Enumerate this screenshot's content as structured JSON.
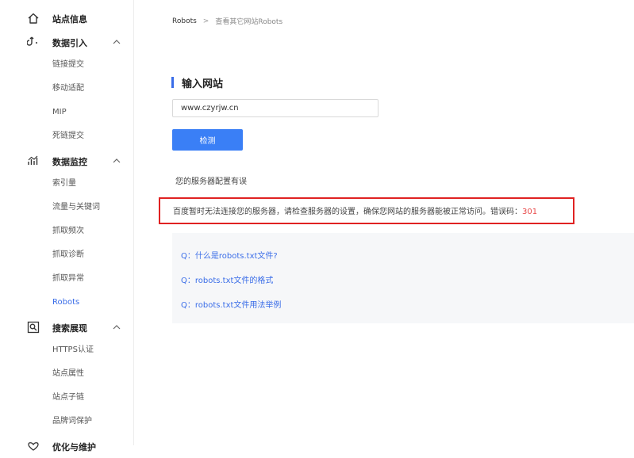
{
  "sidebar": {
    "groups": [
      {
        "label": "站点信息",
        "icon": "home-icon"
      },
      {
        "label": "数据引入",
        "icon": "data-import-icon",
        "items": [
          "链接提交",
          "移动适配",
          "MIP",
          "死链提交"
        ]
      },
      {
        "label": "数据监控",
        "icon": "data-monitor-icon",
        "items": [
          "索引量",
          "流量与关键词",
          "抓取频次",
          "抓取诊断",
          "抓取异常",
          "Robots"
        ]
      },
      {
        "label": "搜索展现",
        "icon": "search-display-icon",
        "items": [
          "HTTPS认证",
          "站点属性",
          "站点子链",
          "品牌词保护"
        ]
      },
      {
        "label": "优化与维护",
        "icon": "optimize-icon"
      }
    ],
    "active_item": "Robots"
  },
  "breadcrumb": {
    "root": "Robots",
    "separator": ">",
    "current": "查看其它网站Robots"
  },
  "section": {
    "title": "输入网站"
  },
  "form": {
    "url_value": "www.czyrjw.cn",
    "check_label": "检测"
  },
  "result": {
    "status": "您的服务器配置有误",
    "error_message": "百度暂时无法连接您的服务器，请检查服务器的设置，确保您网站的服务器能被正常访问。错误码：",
    "error_code": "301"
  },
  "faq": [
    "Q：什么是robots.txt文件?",
    "Q：robots.txt文件的格式",
    "Q：robots.txt文件用法举例"
  ],
  "colors": {
    "accent": "#3a6de8",
    "button": "#3a7ff6",
    "error_border": "#e02222",
    "error_code": "#e84a4a"
  }
}
